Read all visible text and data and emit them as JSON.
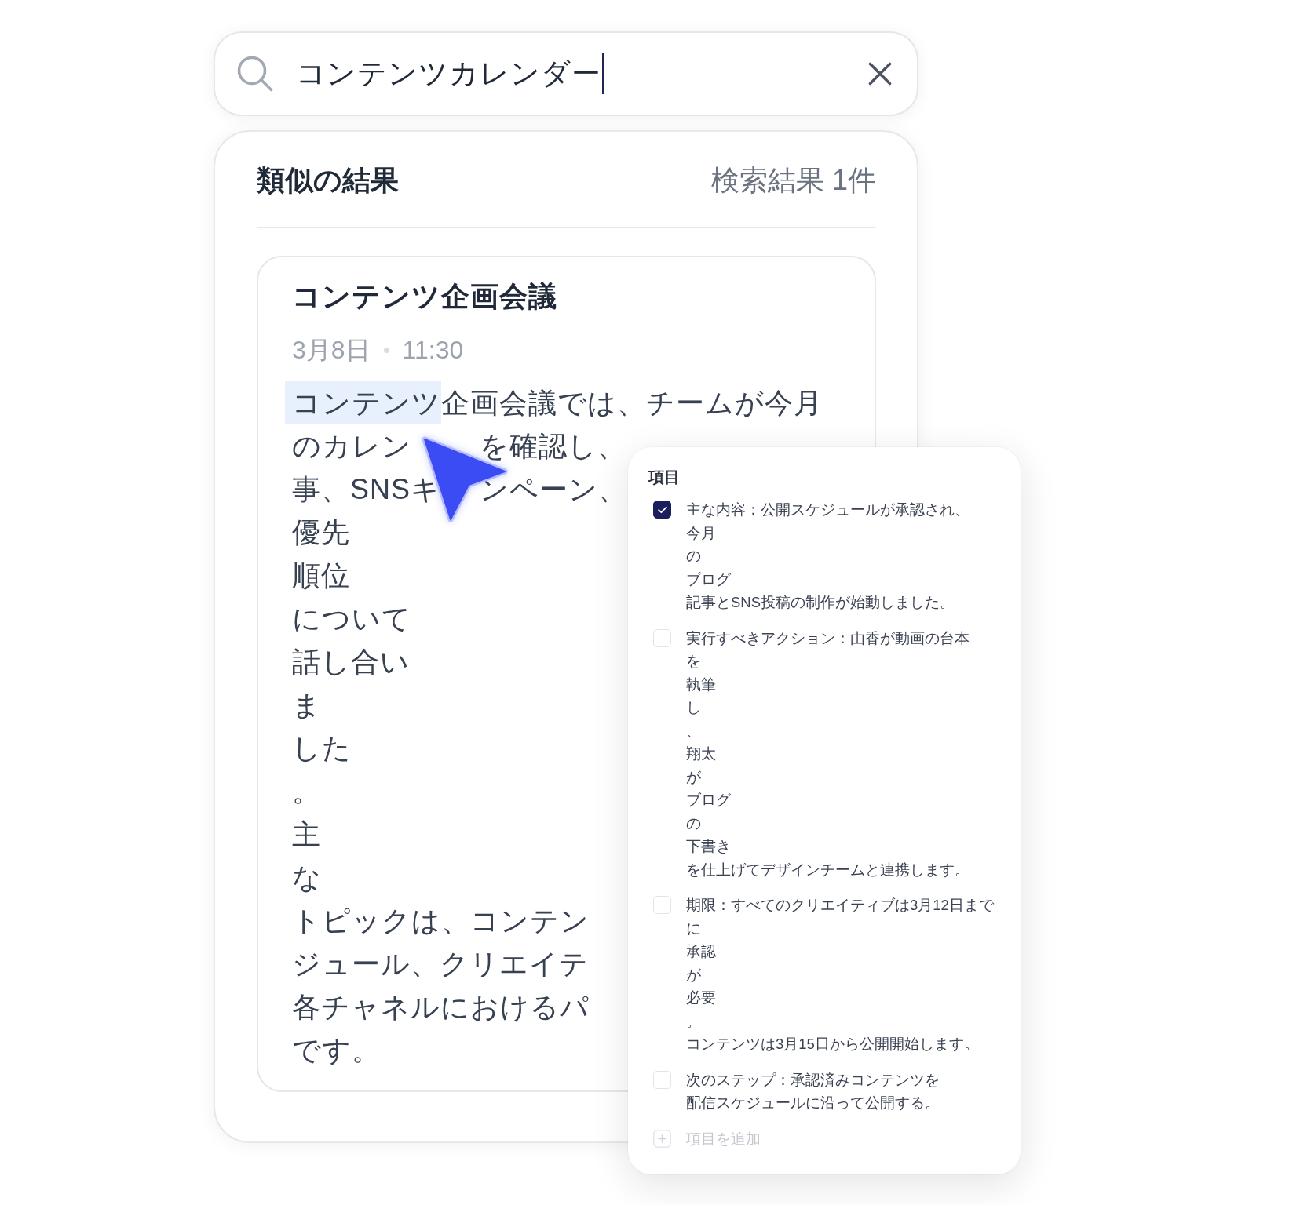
{
  "search": {
    "value": "コンテンツカレンダー",
    "focused": true
  },
  "results": {
    "title": "類似の結果",
    "count": "検索結果 1件",
    "items": [
      {
        "title": "コンテンツ企画会議",
        "date": "3月8日",
        "time": "11:30",
        "body_lines": [
          {
            "kind": "plain",
            "runs": [
              {
                "text": "コンテンツ",
                "highlight": true
              },
              {
                "text": "企画会議では、チームが今月",
                "highlight": false
              }
            ]
          },
          {
            "kind": "split",
            "runs": [
              {
                "text": "のカレン",
                "highlight": false
              },
              {
                "text": "を確認し、",
                "highlight": false
              }
            ]
          },
          {
            "kind": "split",
            "runs": [
              {
                "text": "事、SNSキ",
                "highlight": false
              },
              {
                "text": "ンペーン、",
                "highlight": false
              }
            ]
          },
          {
            "kind": "plain",
            "runs": [
              {
                "text": "優先",
                "highlight": false
              }
            ]
          },
          {
            "kind": "plain",
            "runs": [
              {
                "text": "順位",
                "highlight": false
              }
            ]
          },
          {
            "kind": "plain",
            "runs": [
              {
                "text": "について",
                "highlight": false
              }
            ]
          },
          {
            "kind": "plain",
            "runs": [
              {
                "text": "話し合い",
                "highlight": false
              }
            ]
          },
          {
            "kind": "plain",
            "runs": [
              {
                "text": "ま",
                "highlight": false
              }
            ]
          },
          {
            "kind": "plain",
            "runs": [
              {
                "text": "した",
                "highlight": false
              }
            ]
          },
          {
            "kind": "plain",
            "runs": [
              {
                "text": "。",
                "highlight": false
              }
            ]
          },
          {
            "kind": "plain",
            "runs": [
              {
                "text": "主",
                "highlight": false
              }
            ]
          },
          {
            "kind": "plain",
            "runs": [
              {
                "text": "な",
                "highlight": false
              }
            ]
          },
          {
            "kind": "plain",
            "runs": [
              {
                "text": "トピックは、コンテン",
                "highlight": false
              }
            ]
          },
          {
            "kind": "plain",
            "runs": [
              {
                "text": "ジュール、クリエイテ",
                "highlight": false
              }
            ]
          },
          {
            "kind": "plain",
            "runs": [
              {
                "text": "各チャネルにおけるパ",
                "highlight": false
              }
            ]
          },
          {
            "kind": "plain",
            "runs": [
              {
                "text": "です。",
                "highlight": false
              }
            ]
          }
        ]
      }
    ]
  },
  "checklist": {
    "title": "項目",
    "items": [
      {
        "lines": [
          "主な内容：公開スケジュールが承認され、",
          "今月",
          "の",
          "ブログ",
          "記事とSNS投稿の制作が始動しました。"
        ],
        "checked": true
      },
      {
        "lines": [
          "実行すべきアクション：由香が動画の台本",
          "を",
          "執筆",
          "し",
          "、",
          "翔太",
          "が",
          "ブログ",
          "の",
          "下書き",
          "を仕上げてデザインチームと連携します。"
        ],
        "checked": false
      },
      {
        "lines": [
          "期限：すべてのクリエイティブは3月12日まで",
          "に",
          "承認",
          "が",
          "必要",
          "。",
          "コンテンツは3月15日から公開開始します。"
        ],
        "checked": false
      },
      {
        "lines": [
          "次のステップ：承認済みコンテンツを",
          "配信スケジュールに沿って公開する。"
        ],
        "checked": false
      }
    ],
    "add_label": "項目を追加"
  }
}
